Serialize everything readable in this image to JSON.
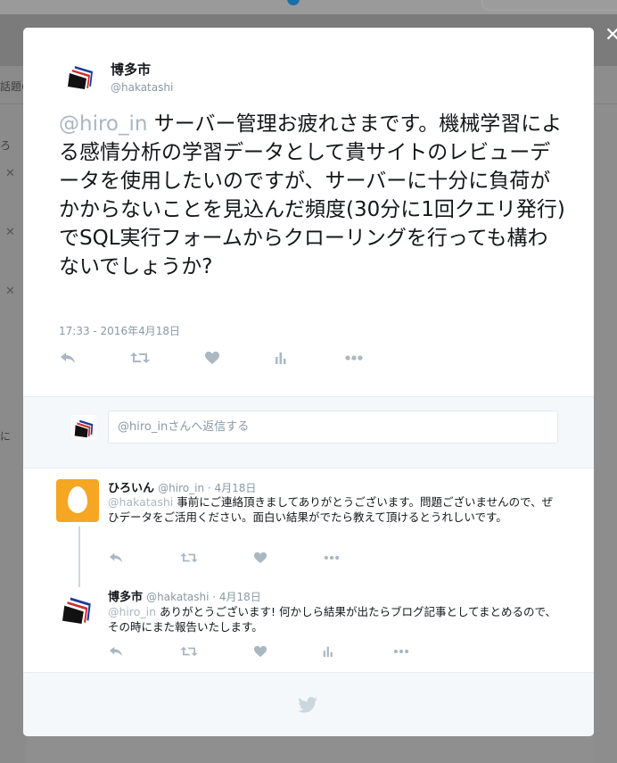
{
  "background": {
    "strip_text": "話題の",
    "side_char": "に"
  },
  "modal": {
    "close_glyph": "✕"
  },
  "tweet": {
    "author_name": "博多市",
    "author_handle": "@hakatashi",
    "mention": "@hiro_in",
    "body": " サーバー管理お疲れさまです。機械学習による感情分析の学習データとして貴サイトのレビューデータを使用したいのですが、サーバーに十分に負荷がかからないことを見込んだ頻度(30分に1回クエリ発行)でSQL実行フォームからクローリングを行っても構わないでしょうか?",
    "timestamp": "17:33 - 2016年4月18日",
    "actions": [
      "reply-icon",
      "retweet-icon",
      "like-icon",
      "analytics-icon",
      "more-icon"
    ]
  },
  "reply_box": {
    "placeholder": "@hiro_inさんへ返信する"
  },
  "conversation": [
    {
      "name": "ひろいん",
      "handle": "@hiro_in · 4月18日",
      "mention": "@hakatashi",
      "text": " 事前にご連絡頂きましてありがとうございます。問題ございませんので、ぜひデータをご活用ください。面白い結果がでたら教えて頂けるとうれしいです。",
      "avatar": "egg-avatar"
    },
    {
      "name": "博多市",
      "handle": "@hakatashi · 4月18日",
      "mention": "@hiro_in",
      "text": " ありがとうございます! 何かしら結果が出たらブログ記事としてまとめるので、その時にまた報告いたします。",
      "avatar": "logo-avatar"
    }
  ],
  "colors": {
    "text": "#14171a",
    "muted": "#8899a6",
    "icon": "#aab8c2",
    "egg": "#f5a623"
  }
}
